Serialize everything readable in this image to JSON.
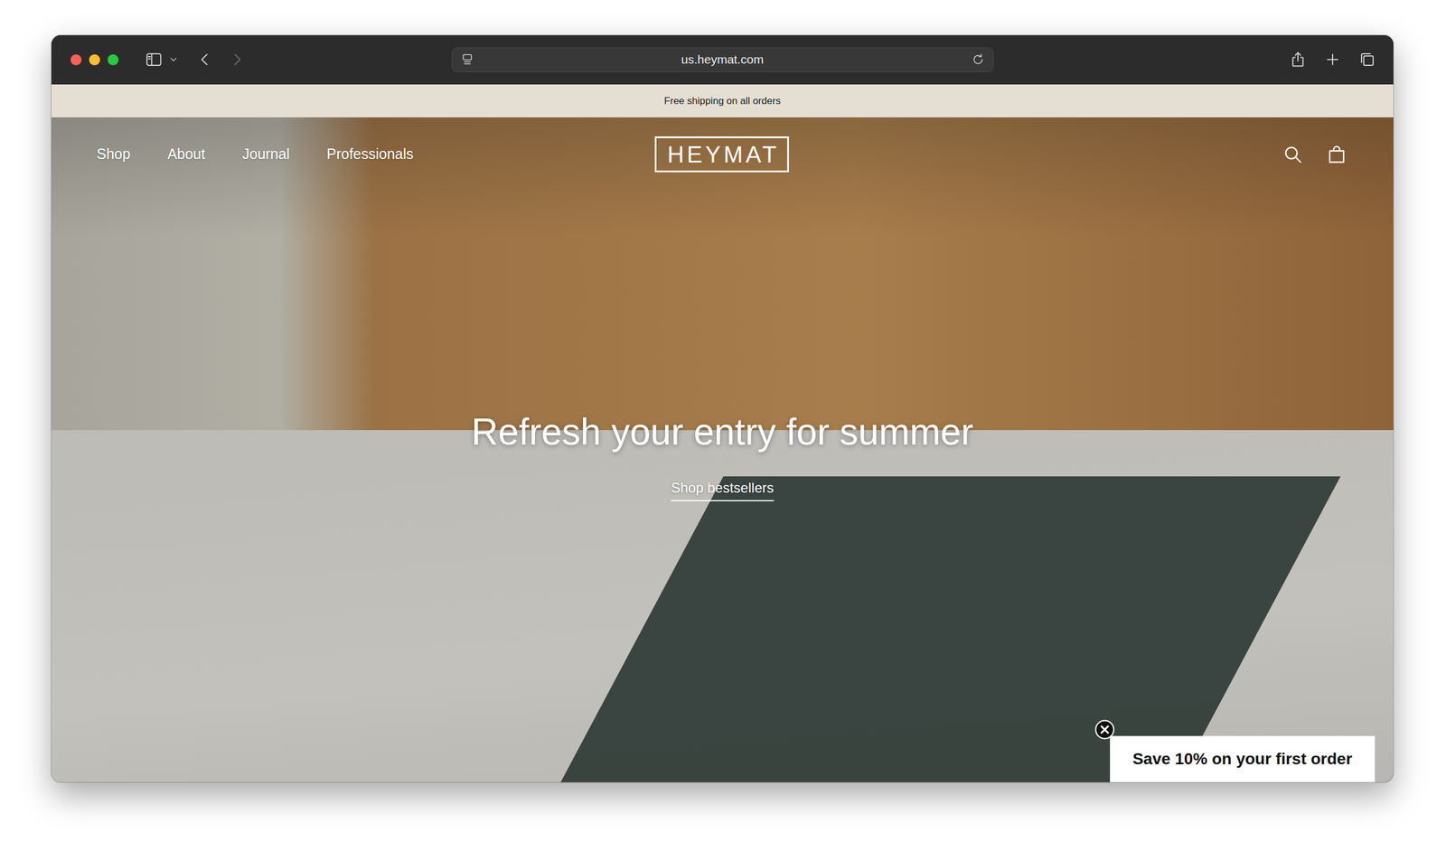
{
  "browser": {
    "url": "us.heymat.com",
    "back_enabled": true,
    "forward_enabled": false
  },
  "announcement": "Free shipping on all orders",
  "nav": {
    "items": [
      {
        "label": "Shop"
      },
      {
        "label": "About"
      },
      {
        "label": "Journal"
      },
      {
        "label": "Professionals"
      }
    ],
    "logo": "HEYMAT"
  },
  "hero": {
    "headline": "Refresh your entry for summer",
    "link": "Shop bestsellers"
  },
  "popup": {
    "label": "Save 10% on your first order"
  }
}
